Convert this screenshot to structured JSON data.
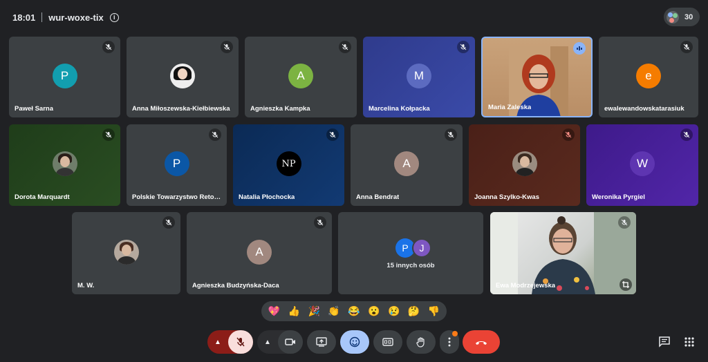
{
  "meeting": {
    "time": "18:01",
    "code": "wur-woxe-tix",
    "participant_count": "30"
  },
  "tiles": [
    {
      "name": "Paweł Sarna",
      "initial": "P",
      "color": "#129eaf"
    },
    {
      "name": "Anna Miłoszewska-Kiełbiewska",
      "initial": "",
      "color": ""
    },
    {
      "name": "Agnieszka Kampka",
      "initial": "A",
      "color": "#7cb342"
    },
    {
      "name": "Marcelina Kołpacka",
      "initial": "M",
      "color": "#5c6bc0"
    },
    {
      "name": "Maria Zaleska",
      "initial": "",
      "color": ""
    },
    {
      "name": "ewalewandowskatarasiuk",
      "initial": "e",
      "color": "#f57c00"
    },
    {
      "name": "Dorota Marquardt",
      "initial": "",
      "color": ""
    },
    {
      "name": "Polskie Towarzystwo Retor...",
      "initial": "P",
      "color": "#0b57a6"
    },
    {
      "name": "Natalia Płochocka",
      "initial": "NP",
      "color": "#000000"
    },
    {
      "name": "Anna Bendrat",
      "initial": "A",
      "color": "#a1887f"
    },
    {
      "name": "Joanna Szylko-Kwas",
      "initial": "",
      "color": ""
    },
    {
      "name": "Weronika Pyrgiel",
      "initial": "W",
      "color": "#5e35b1"
    },
    {
      "name": "M. W.",
      "initial": "",
      "color": ""
    },
    {
      "name": "Agnieszka Budzyńska-Daca",
      "initial": "A",
      "color": "#a1887f"
    },
    {
      "name": "Ewa Modrzejewska",
      "initial": "",
      "color": ""
    }
  ],
  "others": {
    "label": "15 innych osób",
    "initials": [
      "P",
      "J"
    ],
    "colors": [
      "#1a73e8",
      "#7e57c2"
    ]
  },
  "reactions": [
    "💖",
    "👍",
    "🎉",
    "👏",
    "😂",
    "😮",
    "😢",
    "🤔",
    "👎"
  ],
  "colors": {
    "background": "#202124",
    "tile": "#3c4043",
    "mic_off_bg": "#8c1d18",
    "end_call": "#ea4335",
    "active_speaker": "#8ab4f8",
    "reactions_active": "#a8c7fa"
  }
}
